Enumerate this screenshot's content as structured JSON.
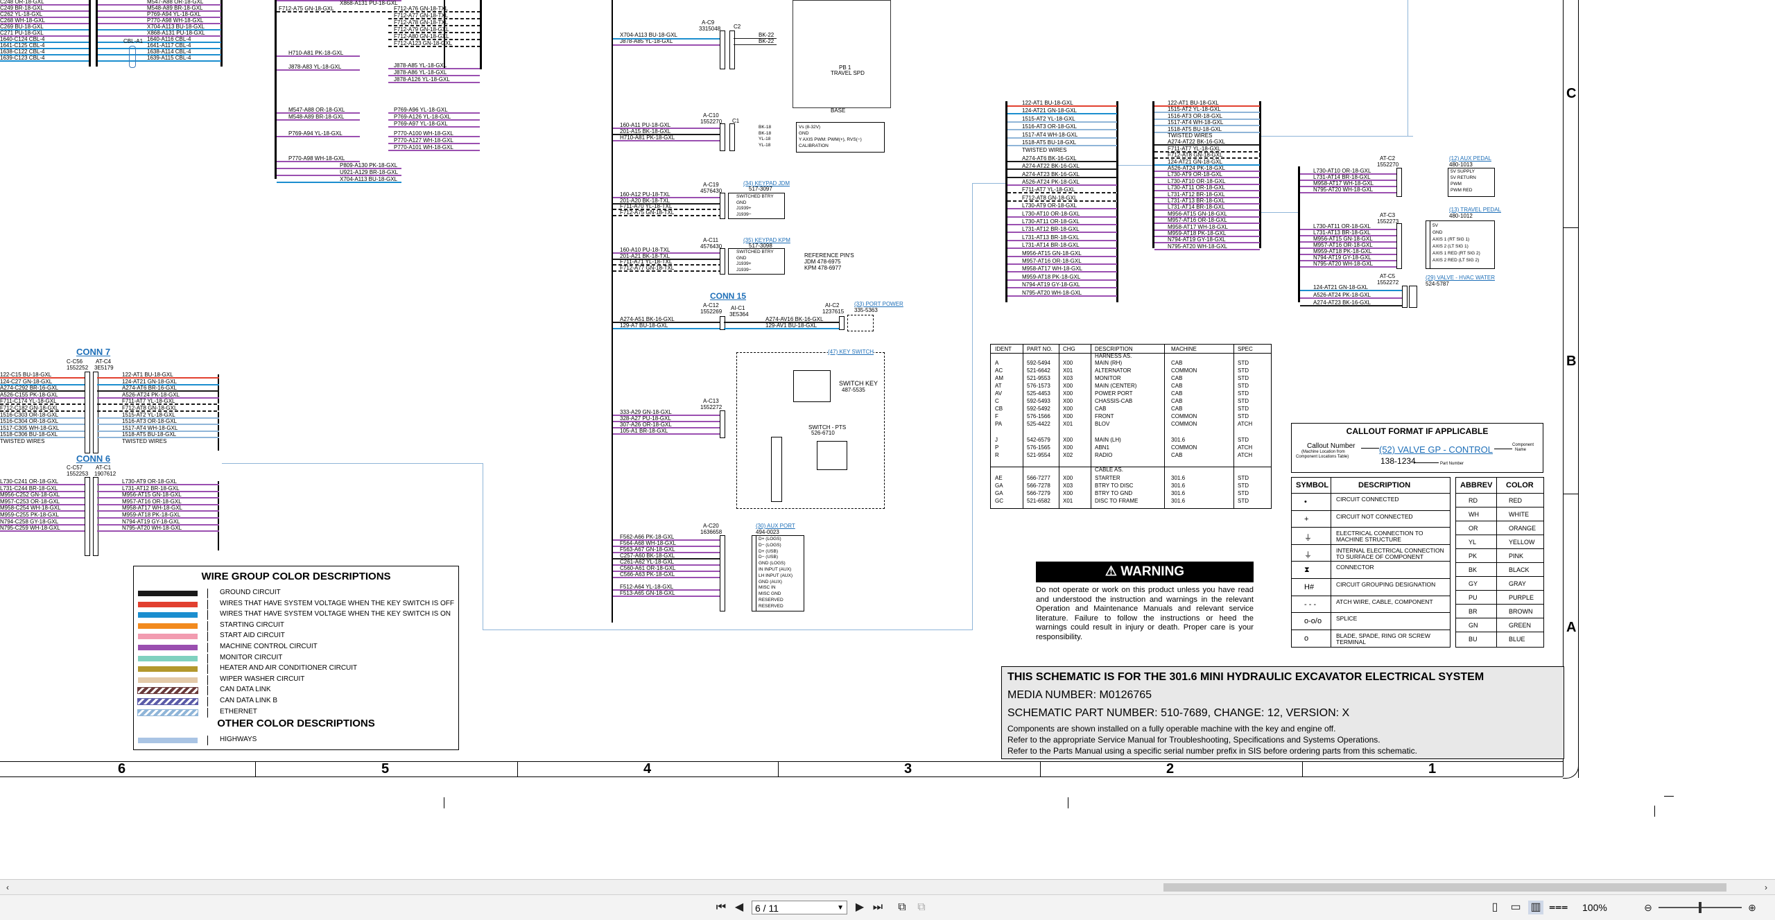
{
  "document": {
    "connectors_left": {
      "conn7_label": "CONN 7",
      "conn6_label": "CONN 6",
      "conn7_left_id": "C-C56",
      "conn7_left_num": "1552252",
      "conn7_right_id": "AT-C4",
      "conn7_right_num": "3E5179",
      "conn6_left_id": "C-C57",
      "conn6_left_num": "1552253",
      "conn6_right_id": "AT-C1",
      "conn6_right_num": "1907612",
      "conn7_wires_left": [
        "122-C15 BU-18-GXL",
        "124-C27 GN-18-GXL",
        "A274-C292 BR-16-GXL",
        "A526-C155 PK-18-GXL",
        "F711-C174 YL-18-GXL",
        "F712-C182 GN-18-GXL",
        "1516-C303 OR-18-GXL",
        "1516-C304 OR-18-GXL",
        "1517-C305 WH-18-GXL",
        "1518-C306 BU-18-GXL",
        "TWISTED WIRES"
      ],
      "conn7_wires_right": [
        "122-AT1 BU-18-GXL",
        "124-AT21 GN-18-GXL",
        "A274-AT6 BR-16-GXL",
        "A526-AT24 PK-18-GXL",
        "F711-AT7 YL-18-GXL",
        "F712-AT8 GN-18-GXL",
        "1515-AT2 YL-18-GXL",
        "1516-AT3 OR-18-GXL",
        "1517-AT4 WH-18-GXL",
        "1518-AT5 BU-18-GXL",
        "TWISTED WIRES"
      ],
      "conn6_wires_left": [
        "L730-C241 OR-18-GXL",
        "L731-C244 BR-18-GXL",
        "M956-C252 GN-18-GXL",
        "M957-C253 OR-18-GXL",
        "M958-C254 WH-18-GXL",
        "M959-C255 PK-18-GXL",
        "N794-C258 GY-18-GXL",
        "N795-C259 WH-18-GXL"
      ],
      "conn6_wires_right": [
        "L730-AT9 OR-18-GXL",
        "L731-AT12 BR-18-GXL",
        "M956-AT15 GN-18-GXL",
        "M957-AT16 OR-18-GXL",
        "M958-AT17 WH-18-GXL",
        "M959-AT18 PK-18-GXL",
        "N794-AT19 GY-18-GXL",
        "N795-AT20 WH-18-GXL"
      ]
    },
    "top_left_wires": [
      "C248 OR-18-GXL",
      "C249 BR-18-GXL",
      "C262 YL-18-GXL",
      "C268 WH-18-GXL",
      "C269 BU-18-GXL",
      "C271 PU-18-GXL",
      "1640-C124 CBL-4",
      "1641-C125 CBL-4",
      "1638-C122 CBL-4",
      "1639-C123 CBL-4"
    ],
    "top_left_wires_right": [
      "M547-A88 OR-18-GXL",
      "M548-A89 BR-18-GXL",
      "P769-A94 YL-18-GXL",
      "P770-A98 WH-18-GXL",
      "X704-A113 BU-18-GXL",
      "X868-A131 PU-18-GXL",
      "1640-A116 CBL-4",
      "1641-A117 CBL-4",
      "1638-A114 CBL-4",
      "1639-A115 CBL-4"
    ],
    "cbl_label": "CBL-A1",
    "middle_left_wires": [
      "F712-A75 GN-18-GXL",
      "H710-A81 PK-18-GXL",
      "J878-A83 YL-18-GXL",
      "M547-A88 OR-18-GXL",
      "M548-A89 BR-18-GXL",
      "P769-A94 YL-18-GXL",
      "P770-A98 WH-18-GXL",
      "P809-A130 PK-18-GXL",
      "U921-A129 BR-18-GXL",
      "X704-A113 BU-18-GXL",
      "X868-A131 PU-18-GXL"
    ],
    "middle_right_wires": [
      "F712-A76 GN-18-TXL",
      "F712-A77 GN-18-TXL",
      "F712-A78 GN-18-TXL",
      "F712-A79 GN-18-GXL",
      "F712-A80 GN-18-GXL",
      "F712-A123 GN-18-GXL",
      "J878-A85 YL-18-GXL",
      "J878-A86 YL-18-GXL",
      "J878-A126 YL-18-GXL",
      "P769-A96 YL-18-GXL",
      "P769-A126 YL-18-GXL",
      "P769-A97 YL-18-GXL",
      "P770-A100 WH-18-GXL",
      "P770-A127 WH-18-GXL",
      "P770-A101 WH-18-GXL"
    ],
    "center": {
      "c9_id": "A-C9",
      "c9_num": "3315048",
      "c2_label": "C2",
      "c9_wires": [
        "X704-A113 BU-18-GXL",
        "J878-A85 YL-18-GXL"
      ],
      "c9_right": [
        "BK-22",
        "BK-22"
      ],
      "pb1": "PB 1",
      "travel_spd": "TRAVEL SPD",
      "base_label": "BASE",
      "c10_id": "A-C10",
      "c10_num": "1552270",
      "c1_label": "C1",
      "c10_wires": [
        "160-A11 PU-18-GXL",
        "201-A15 BK-18-GXL",
        "H710-A81 PK-18-GXL"
      ],
      "c10_right": [
        "BK-18",
        "BK-18",
        "YL-18",
        "YL-18"
      ],
      "c10_box": [
        "Vs (8-32V)",
        "GND",
        "Y AXIS PWM: PWM(+), RVS(−)",
        "CALIBRATION"
      ],
      "c19_id": "A-C19",
      "c19_num": "4576430",
      "c19_link": "(34) KEYPAD JDM",
      "c19_part": "517-3097",
      "c19_wires": [
        "160-A12 PU-18-TXL",
        "201-A20 BK-18-TXL",
        "F711-A70 YL-18-TXL",
        "F712-A75 GN-18-TXL"
      ],
      "c19_box": [
        "SWITCHED BTRY",
        "GND",
        "J1939+",
        "J1939−"
      ],
      "c11_id": "A-C11",
      "c11_num": "4576430",
      "c11_link": "(35) KEYPAD KPM",
      "c11_part": "517-3098",
      "c11_wires": [
        "160-A10 PU-18-TXL",
        "201-A21 BK-18-TXL",
        "F711-A71 YL-18-TXL",
        "F712-A77 GN-18-TXL"
      ],
      "c11_box": [
        "SWITCHED BTRY",
        "GND",
        "J1939+",
        "J1939−"
      ],
      "ref_pins": [
        "REFERENCE PIN'S",
        "JDM 478-6975",
        "KPM 478-6977"
      ],
      "conn15_label": "CONN 15",
      "c12_id": "A-C12",
      "c12_num": "1552269",
      "ai_c1": "AI-C1",
      "ai_c1_num": "3E5364",
      "ai_c2": "AI-C2",
      "ai_c2_num": "1237615",
      "c12_wires": [
        "A274-A51 BK-16-GXL",
        "129-A7 BU-18-GXL"
      ],
      "c12_right": [
        "A274-AV16 BK-16-GXL",
        "129-AV1 BU-18-GXL"
      ],
      "port_power": "(33) PORT POWER",
      "port_power_part": "335-5363",
      "key_switch_link": "(47) KEY SWITCH",
      "c13_id": "A-C13",
      "c13_num": "1552272",
      "c13_wires": [
        "333-A29 GN-18-GXL",
        "328-A27 PU-18-GXL",
        "307-A26 OR-18-GXL",
        "105-A1 BR-18-GXL"
      ],
      "switch_key": "SWITCH KEY",
      "switch_key_part": "487-5535",
      "sw_pts": "SWITCH - PTS",
      "sw_pts_part": "526-6710",
      "c20_id": "A-C20",
      "c20_num": "1636658",
      "aux_port": "(30) AUX PORT",
      "aux_port_part": "494-0023",
      "c20_wires": [
        "F562-A66 PK-18-GXL",
        "F564-A68 WH-18-GXL",
        "F563-A67 GN-18-GXL",
        "C257-A60 BK-18-GXL",
        "C261-A62 YL-18-GXL",
        "C560-A61 OR-18-GXL",
        "C566-A63 PK-18-GXL",
        "F512-A64 YL-18-GXL",
        "F513-A65 GN-18-GXL"
      ],
      "c20_box": [
        "D+ (LOGS)",
        "D− (LOGS)",
        "D+ (USB)",
        "D− (USB)",
        "GND (LOGS)",
        "IN INPUT (AUX)",
        "LH INPUT (AUX)",
        "GND (AUX)",
        "MISC IN",
        "MISC GND",
        "RESERVED",
        "RESERVED"
      ]
    },
    "right_group1": [
      "122-AT1 BU-18-GXL",
      "124-AT21 GN-18-GXL",
      "1515-AT2 YL-18-GXL",
      "1516-AT3 OR-18-GXL",
      "1517-AT4 WH-18-GXL",
      "1518-AT5 BU-18-GXL",
      "TWISTED WIRES",
      "A274-AT6 BK-16-GXL",
      "A274-AT22 BK-16-GXL",
      "A274-AT23 BK-16-GXL",
      "A526-AT24 PK-18-GXL",
      "F711-AT7 YL-18-GXL",
      "F712-AT8 GN-18-GXL",
      "L730-AT9 OR-18-GXL",
      "L730-AT10 OR-18-GXL",
      "L730-AT11 OR-18-GXL",
      "L731-AT12 BR-18-GXL",
      "L731-AT13 BR-18-GXL",
      "L731-AT14 BR-18-GXL",
      "M956-AT15 GN-18-GXL",
      "M957-AT16 OR-18-GXL",
      "M958-AT17 WH-18-GXL",
      "M959-AT18 PK-18-GXL",
      "N794-AT19 GY-18-GXL",
      "N795-AT20 WH-18-GXL"
    ],
    "right_group2": [
      "122-AT1 BU-18-GXL",
      "1515-AT2 YL-18-GXL",
      "1516-AT3 OR-18-GXL",
      "1517-AT4 WH-18-GXL",
      "1518-AT5 BU-18-GXL",
      "TWISTED WIRES",
      "A274-AT22 BK-16-GXL",
      "F711-AT7 YL-18-GXL",
      "F712-AT8 GN-18-GXL",
      "124-AT21 GN-18-GXL",
      "A526-AT24 PK-18-GXL",
      "L730-AT9 OR-18-GXL",
      "L730-AT10 OR-18-GXL",
      "L730-AT11 OR-18-GXL",
      "L731-AT12 BR-18-GXL",
      "L731-AT13 BR-18-GXL",
      "L731-AT14 BR-18-GXL",
      "M956-AT15 GN-18-GXL",
      "M957-AT16 OR-18-GXL",
      "M958-AT17 WH-18-GXL",
      "M959-AT18 PK-18-GXL",
      "N794-AT19 GY-18-GXL",
      "N795-AT20 WH-18-GXL"
    ],
    "far_right": {
      "c2_id": "AT-C2",
      "c2_num": "1552270",
      "aux_pedal": "(12) AUX PEDAL",
      "aux_pedal_part": "480-1013",
      "c2_wires": [
        "L730-AT10 OR-18-GXL",
        "L731-AT14 BR-18-GXL",
        "M958-AT17 WH-18-GXL",
        "N795-AT20 WH-18-GXL"
      ],
      "c2_box": [
        "5V SUPPLY",
        "5V RETURN",
        "PWM",
        "PWM RED"
      ],
      "c3_id": "AT-C3",
      "c3_num": "1552273",
      "travel_pedal": "(13) TRAVEL PEDAL",
      "travel_pedal_part": "480-1012",
      "c3_wires": [
        "L730-AT11 OR-18-GXL",
        "L731-AT13 BR-18-GXL",
        "M956-AT15 GN-18-GXL",
        "M957-AT16 OR-18-GXL",
        "M959-AT18 PK-18-GXL",
        "N794-AT19 GY-18-GXL",
        "N795-AT20 WH-18-GXL"
      ],
      "c3_box": [
        "5V",
        "GND",
        "AXIS 1 (RT SIG 1)",
        "AXIS 2 (LT SIG 1)",
        "AXIS 1 RED (RT SIG 2)",
        "AXIS 2 RED (LT SIG 2)"
      ],
      "c5_id": "AT-C5",
      "c5_num": "1552272",
      "hvac_valve": "(29) VALVE - HVAC WATER",
      "hvac_part": "524-5787",
      "c5_wires": [
        "124-AT21 GN-18-GXL",
        "A526-AT24 PK-18-GXL",
        "A274-AT23 BK-16-GXL"
      ]
    },
    "harness_table": {
      "headers": [
        "IDENT",
        "PART NO.",
        "CHG",
        "DESCRIPTION",
        "MACHINE",
        "SPEC"
      ],
      "harness_as": "HARNESS AS.",
      "cable_as": "CABLE AS.",
      "rows": [
        [
          "A",
          "592-5494",
          "X00",
          "MAIN (RH)",
          "CAB",
          "STD"
        ],
        [
          "AC",
          "521-6642",
          "X01",
          "ALTERNATOR",
          "COMMON",
          "STD"
        ],
        [
          "AM",
          "521-9553",
          "X03",
          "MONITOR",
          "CAB",
          "STD"
        ],
        [
          "AT",
          "576-1573",
          "X00",
          "MAIN (CENTER)",
          "CAB",
          "STD"
        ],
        [
          "AV",
          "525-4453",
          "X00",
          "POWER PORT",
          "CAB",
          "STD"
        ],
        [
          "C",
          "592-5493",
          "X00",
          "CHASSIS-CAB",
          "CAB",
          "STD"
        ],
        [
          "CB",
          "592-5492",
          "X00",
          "CAB",
          "CAB",
          "STD"
        ],
        [
          "F",
          "576-1566",
          "X00",
          "FRONT",
          "COMMON",
          "STD"
        ],
        [
          "PA",
          "525-4422",
          "X01",
          "BLOV",
          "COMMON",
          "ATCH"
        ],
        [
          "J",
          "542-6579",
          "X00",
          "MAIN (LH)",
          "301.6",
          "STD"
        ],
        [
          "P",
          "576-1565",
          "X00",
          "ABN1",
          "COMMON",
          "ATCH"
        ],
        [
          "R",
          "521-9554",
          "X02",
          "RADIO",
          "CAB",
          "ATCH"
        ]
      ],
      "cable_rows": [
        [
          "AE",
          "566-7277",
          "X00",
          "STARTER",
          "301.6",
          "STD"
        ],
        [
          "GA",
          "566-7278",
          "X03",
          "BTRY TO DISC",
          "301.6",
          "STD"
        ],
        [
          "GA",
          "566-7279",
          "X00",
          "BTRY TO GND",
          "301.6",
          "STD"
        ],
        [
          "GC",
          "521-6582",
          "X01",
          "DISC TO FRAME",
          "301.6",
          "STD"
        ]
      ]
    },
    "callout": {
      "title": "CALLOUT FORMAT IF APPLICABLE",
      "callout_number": "Callout Number",
      "machine_location": "(Machine Location from",
      "component_locations": "Component Locations Table)",
      "example": "(52) VALVE GP - CONTROL",
      "component_name": "Component",
      "component_name2": "Name",
      "part_number": "Part Number",
      "part_example": "138-1234"
    },
    "symbols": {
      "headers": [
        "SYMBOL",
        "DESCRIPTION"
      ],
      "rows": [
        [
          "CIRCUIT CONNECTED"
        ],
        [
          "CIRCUIT NOT CONNECTED"
        ],
        [
          "ELECTRICAL CONNECTION TO MACHINE STRUCTURE"
        ],
        [
          "INTERNAL ELECTRICAL CONNECTION TO SURFACE OF COMPONENT"
        ],
        [
          "CONNECTOR"
        ],
        [
          "CIRCUIT GROUPING DESIGNATION"
        ],
        [
          "ATCH WIRE, CABLE, COMPONENT"
        ],
        [
          "SPLICE"
        ],
        [
          "BLADE, SPADE, RING OR SCREW TERMINAL"
        ]
      ],
      "glyphs": [
        "•",
        "+",
        "⏚",
        "⏚",
        "⧗",
        "H#",
        "- - -",
        "o-o/o",
        "o"
      ]
    },
    "colors": {
      "headers": [
        "ABBREV",
        "COLOR"
      ],
      "rows": [
        [
          "RD",
          "RED"
        ],
        [
          "WH",
          "WHITE"
        ],
        [
          "OR",
          "ORANGE"
        ],
        [
          "YL",
          "YELLOW"
        ],
        [
          "PK",
          "PINK"
        ],
        [
          "BK",
          "BLACK"
        ],
        [
          "GY",
          "GRAY"
        ],
        [
          "PU",
          "PURPLE"
        ],
        [
          "BR",
          "BROWN"
        ],
        [
          "GN",
          "GREEN"
        ],
        [
          "BU",
          "BLUE"
        ]
      ]
    },
    "wire_legend": {
      "title": "WIRE GROUP COLOR DESCRIPTIONS",
      "rows": [
        {
          "label": "GROUND CIRCUIT",
          "color": "#1a1a1a",
          "pattern": "solid"
        },
        {
          "label": "WIRES THAT HAVE SYSTEM VOLTAGE WHEN THE KEY SWITCH IS OFF",
          "color": "#e2402f",
          "pattern": "solid"
        },
        {
          "label": "WIRES THAT HAVE SYSTEM VOLTAGE WHEN THE KEY SWITCH IS ON",
          "color": "#1b8ecf",
          "pattern": "solid"
        },
        {
          "label": "STARTING CIRCUIT",
          "color": "#f28a1e",
          "pattern": "solid"
        },
        {
          "label": "START AID CIRCUIT",
          "color": "#f29bb0",
          "pattern": "solid"
        },
        {
          "label": "MACHINE CONTROL CIRCUIT",
          "color": "#9a4fb0",
          "pattern": "solid"
        },
        {
          "label": "MONITOR CIRCUIT",
          "color": "#7fd1bf",
          "pattern": "solid"
        },
        {
          "label": "HEATER AND AIR CONDITIONER CIRCUIT",
          "color": "#b3982d",
          "pattern": "solid"
        },
        {
          "label": "WIPER WASHER CIRCUIT",
          "color": "#e3c9a8",
          "pattern": "solid"
        },
        {
          "label": "CAN DATA LINK",
          "color": "#6a3a3a",
          "pattern": "hatch"
        },
        {
          "label": "CAN DATA LINK B",
          "color": "#5b5ba8",
          "pattern": "hatch"
        },
        {
          "label": "ETHERNET",
          "color": "#8fb5d8",
          "pattern": "hatch"
        }
      ],
      "other_title": "OTHER COLOR DESCRIPTIONS",
      "other_rows": [
        {
          "label": "HIGHWAYS",
          "color": "#a9c4e4",
          "pattern": "solid"
        }
      ]
    },
    "warning": {
      "title": "WARNING",
      "text": "Do not operate or work on this product unless you have read and understood the instruction and warnings in the relevant Operation and Maintenance Manuals and relevant service literature. Failure to follow the instructions or heed the warnings could result in injury or death. Proper care is your responsibility."
    },
    "title_block": {
      "line1": "THIS SCHEMATIC IS FOR THE 301.6 MINI HYDRAULIC EXCAVATOR ELECTRICAL SYSTEM",
      "line2": "MEDIA NUMBER: M0126765",
      "line3": "SCHEMATIC PART NUMBER: 510-7689, CHANGE: 12, VERSION: X",
      "line4": "Components are shown installed on a fully operable machine with the key and engine off.",
      "line5": "Refer to the appropriate Service Manual for Troubleshooting, Specifications and Systems Operations.",
      "line6": "Refer to the Parts Manual using a specific serial number prefix in SIS before ordering parts from this schematic."
    },
    "zones_bottom": [
      "6",
      "5",
      "4",
      "3",
      "2",
      "1"
    ],
    "zones_right": [
      "C",
      "B",
      "A"
    ]
  },
  "viewer": {
    "page_display": "6 / 11",
    "zoom": "100%",
    "colors": {
      "toolbar_bg": "#f3f3f3",
      "accent": "#1e6fb8"
    }
  }
}
